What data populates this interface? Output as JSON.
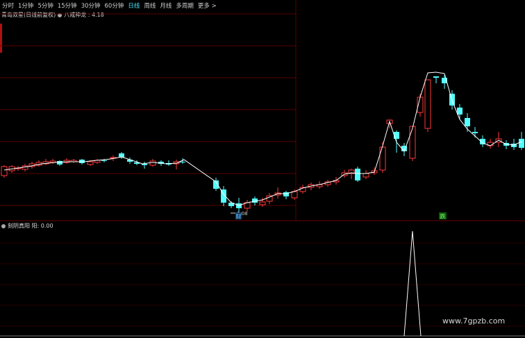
{
  "toolbar": {
    "periods": [
      "分时",
      "1分钟",
      "5分钟",
      "15分钟",
      "30分钟",
      "60分钟",
      "日线",
      "周线",
      "月线",
      "多周期",
      "更多 >"
    ],
    "active_period": "日线"
  },
  "main_chart": {
    "title": "青岛双星(日线前复权)",
    "indicator": "八戒神龙 : 4.18",
    "low_label": "3.08",
    "marker_cai": "财",
    "marker_die": "跌"
  },
  "sub_chart": {
    "title": "刻阴真阳 阳: 0.00"
  },
  "watermark": "www.7gpzb.com",
  "colors": {
    "up": "#ff3a3a",
    "down": "#54ffff",
    "line": "#ffffff",
    "grid": "#5a0000",
    "cai": "#54c8ff",
    "die": "#54ff54"
  }
}
